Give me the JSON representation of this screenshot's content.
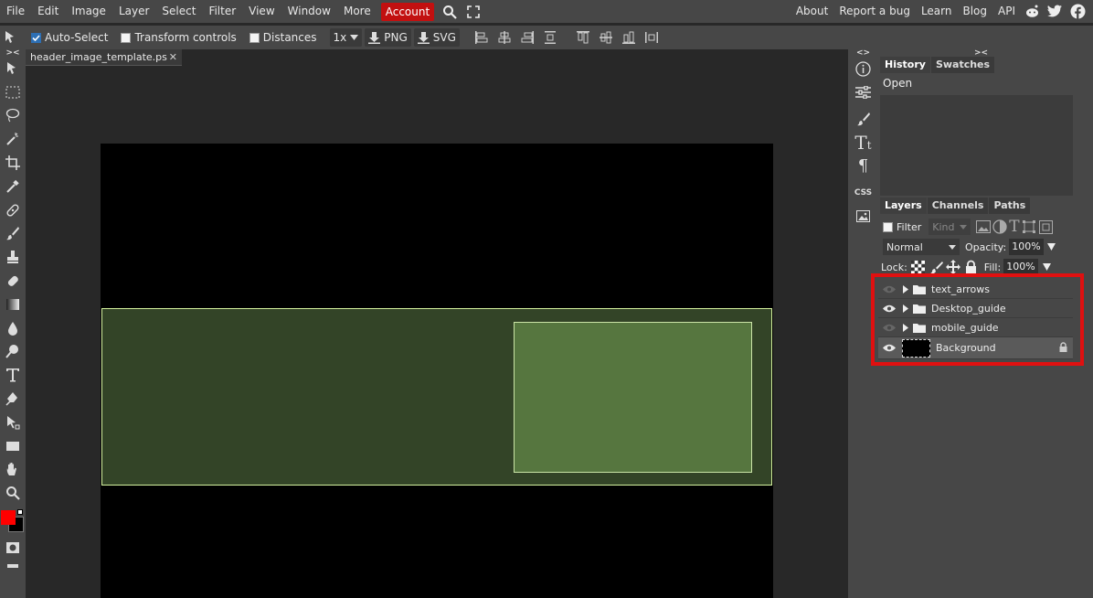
{
  "menubar": {
    "items": [
      "File",
      "Edit",
      "Image",
      "Layer",
      "Select",
      "Filter",
      "View",
      "Window",
      "More"
    ],
    "account": "Account",
    "right_links": [
      "About",
      "Report a bug",
      "Learn",
      "Blog",
      "API"
    ],
    "account_color": "#c21010"
  },
  "options": {
    "auto_select": "Auto-Select",
    "transform_controls": "Transform controls",
    "distances": "Distances",
    "zoom": "1x",
    "png": "PNG",
    "svg": "SVG"
  },
  "document": {
    "tab_title": "header_image_template.ps",
    "close": "✕"
  },
  "collapse": {
    "left": "><",
    "strip": "<>",
    "right": "><"
  },
  "history": {
    "tabs": [
      "History",
      "Swatches"
    ],
    "items": [
      "Open"
    ]
  },
  "layers": {
    "tabs": [
      "Layers",
      "Channels",
      "Paths"
    ],
    "filter_label": "Filter",
    "kind_placeholder": "Kind",
    "blend_mode": "Normal",
    "opacity_label": "Opacity:",
    "opacity_value": "100%",
    "lock_label": "Lock:",
    "fill_label": "Fill:",
    "fill_value": "100%",
    "items": [
      {
        "name": "text_arrows",
        "type": "folder",
        "visible": false
      },
      {
        "name": "Desktop_guide",
        "type": "folder",
        "visible": true
      },
      {
        "name": "mobile_guide",
        "type": "folder",
        "visible": false
      },
      {
        "name": "Background",
        "type": "image",
        "visible": true,
        "locked": true
      }
    ]
  },
  "colors": {
    "foreground": "#ff0000",
    "background": "#000000",
    "highlight": "#e01010",
    "guide_outer": "#334427",
    "guide_inner": "#56763f"
  }
}
